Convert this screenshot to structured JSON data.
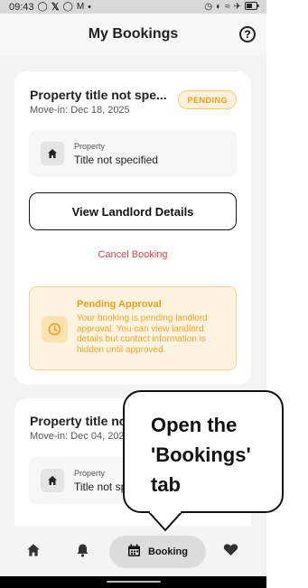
{
  "status_bar": {
    "time": "09:43",
    "left_icons": [
      "whatsapp-icon",
      "x-icon",
      "whatsapp-icon",
      "gmail-icon",
      "dot-icon"
    ],
    "right_icons": [
      "alarm-icon",
      "data-saver-icon",
      "wifi-icon",
      "airplane-icon",
      "battery-icon"
    ]
  },
  "header": {
    "title": "My Bookings",
    "help_icon": "?"
  },
  "bookings": [
    {
      "title": "Property title not spe...",
      "move_in": "Move-in: Dec 18, 2025",
      "status": "PENDING",
      "property_label": "Property",
      "property_value": "Title not specified",
      "view_button": "View Landlord Details",
      "cancel_button": "Cancel Booking",
      "notice_title": "Pending Approval",
      "notice_body": "Your booking is pending landlord approval. You can view landlord details but contact information is hidden until approved."
    },
    {
      "title": "Property title no",
      "move_in": "Move-in: Dec 04, 202",
      "property_label": "Property",
      "property_value": "Title not sp"
    }
  ],
  "nav": {
    "items": [
      "home-icon",
      "bell-icon",
      "calendar-icon",
      "heart-icon"
    ],
    "active_label": "Booking"
  },
  "callout": {
    "text": "Open the 'Bookings' tab"
  },
  "colors": {
    "pending": "#ef9d14",
    "cancel": "#d64545",
    "background": "#f3f3f3"
  }
}
